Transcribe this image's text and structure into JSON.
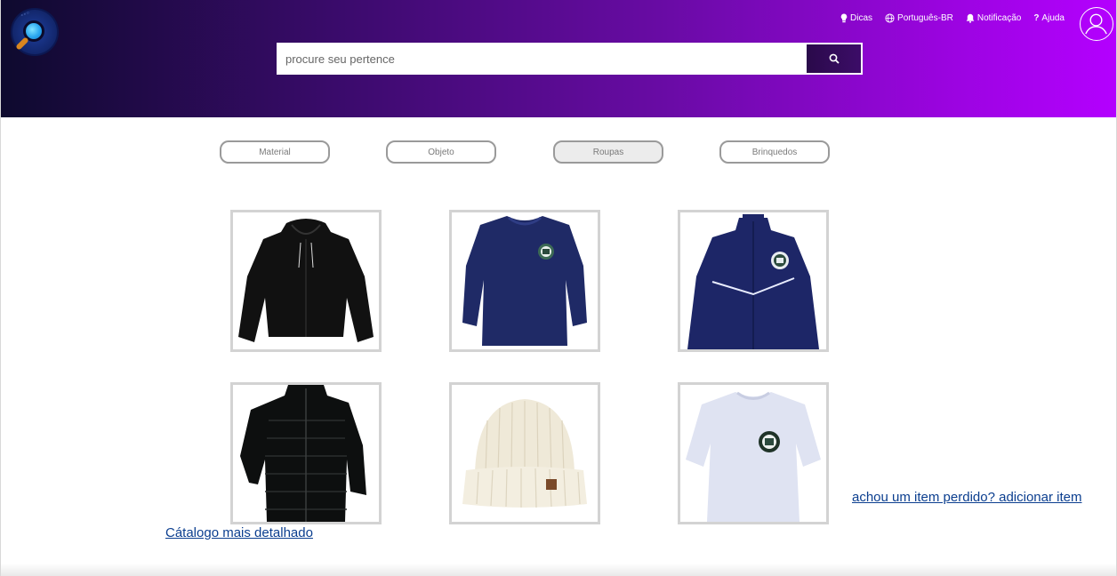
{
  "header": {
    "nav": [
      {
        "label": "Dicas",
        "icon": "lightbulb-icon"
      },
      {
        "label": "Português-BR",
        "icon": "globe-icon"
      },
      {
        "label": "Notificação",
        "icon": "bell-icon"
      },
      {
        "label": "Ajuda",
        "icon": "question-icon"
      }
    ],
    "avatar_icon": "user-avatar-icon",
    "logo_icon": "magnifier-logo-icon"
  },
  "search": {
    "placeholder": "procure seu pertence",
    "button_icon": "search-icon"
  },
  "categories": [
    {
      "label": "Material",
      "selected": false
    },
    {
      "label": "Objeto",
      "selected": false
    },
    {
      "label": "Roupas",
      "selected": true
    },
    {
      "label": "Brinquedos",
      "selected": false
    }
  ],
  "products": [
    {
      "item": "black-hoodie-image"
    },
    {
      "item": "navy-sweatshirt-image"
    },
    {
      "item": "navy-track-jacket-image"
    },
    {
      "item": "black-puffer-jacket-image"
    },
    {
      "item": "cream-beanie-image"
    },
    {
      "item": "white-tshirt-image"
    }
  ],
  "links": {
    "add_item": "achou um item perdido? adicionar item",
    "catalog": "Cátalogo mais detalhado"
  },
  "colors": {
    "header_gradient_start": "#0e0a2e",
    "header_gradient_end": "#b400ff",
    "link": "#0b3e8f"
  }
}
